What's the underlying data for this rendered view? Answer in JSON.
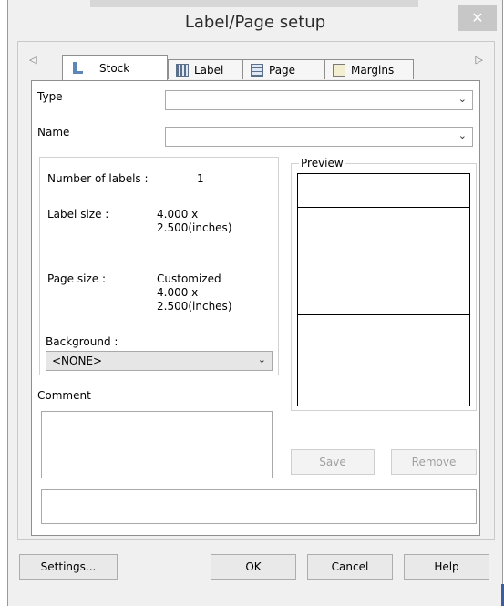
{
  "window": {
    "title": "Label/Page setup",
    "close_label": "✕"
  },
  "tabs": [
    {
      "label": "Stock",
      "icon": "stock-icon"
    },
    {
      "label": "Label",
      "icon": "label-icon"
    },
    {
      "label": "Page",
      "icon": "page-icon"
    },
    {
      "label": "Margins",
      "icon": "margins-icon"
    }
  ],
  "nav": {
    "left": "◁",
    "right": "▷"
  },
  "form": {
    "type_label": "Type",
    "type_value": "",
    "name_label": "Name",
    "name_value": ""
  },
  "info": {
    "num_labels_label": "Number of labels :",
    "num_labels_value": "1",
    "label_size_label": "Label size :",
    "label_size_line1": "4.000 x",
    "label_size_line2": "2.500(inches)",
    "page_size_label": "Page size :",
    "page_size_line1": "Customized",
    "page_size_line2": "4.000 x",
    "page_size_line3": "2.500(inches)",
    "background_label": "Background :",
    "background_value": "<NONE>"
  },
  "preview": {
    "legend": "Preview"
  },
  "comment": {
    "label": "Comment",
    "value": ""
  },
  "actions": {
    "save": "Save",
    "remove": "Remove"
  },
  "status": {
    "value": ""
  },
  "footer": {
    "settings": "Settings...",
    "ok": "OK",
    "cancel": "Cancel",
    "help": "Help"
  },
  "chevron": "⌄"
}
